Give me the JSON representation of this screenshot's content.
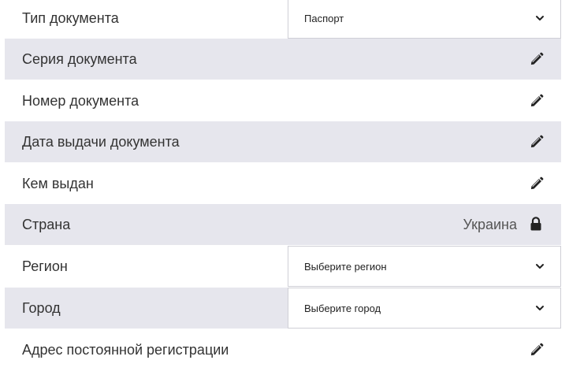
{
  "form": {
    "document_type": {
      "label": "Тип документа",
      "value": "Паспорт",
      "icon": "chevron-down-icon"
    },
    "document_series": {
      "label": "Серия документа",
      "icon": "pencil-icon"
    },
    "document_number": {
      "label": "Номер документа",
      "icon": "pencil-icon"
    },
    "issue_date": {
      "label": "Дата выдачи документа",
      "icon": "pencil-icon"
    },
    "issued_by": {
      "label": "Кем выдан",
      "icon": "pencil-icon"
    },
    "country": {
      "label": "Страна",
      "value": "Украина",
      "icon": "lock-icon"
    },
    "region": {
      "label": "Регион",
      "placeholder": "Выберите регион",
      "icon": "chevron-down-icon"
    },
    "city": {
      "label": "Город",
      "placeholder": "Выберите город",
      "icon": "chevron-down-icon"
    },
    "address": {
      "label": "Адрес постоянной регистрации",
      "icon": "pencil-icon"
    }
  },
  "colors": {
    "row_shaded": "#e6e6ed",
    "text": "#333333",
    "icon": "#222222",
    "select_border": "#cfcfd6"
  }
}
